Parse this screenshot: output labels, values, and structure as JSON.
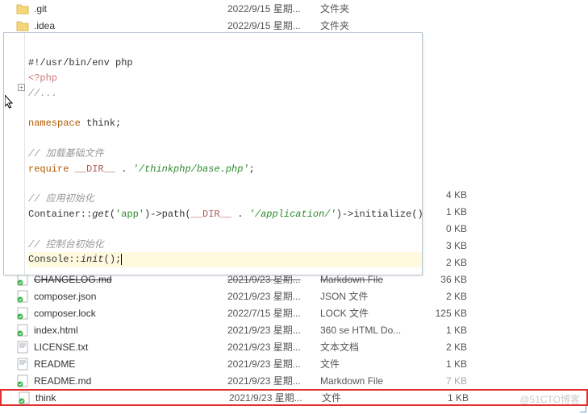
{
  "files": [
    {
      "name": ".git",
      "date": "2022/9/15 星期...",
      "type": "文件夹",
      "size": "",
      "icon": "folder"
    },
    {
      "name": ".idea",
      "date": "2022/9/15 星期...",
      "type": "文件夹",
      "size": "",
      "icon": "folder"
    },
    {
      "name": "",
      "date": "",
      "type": "",
      "size": "",
      "icon": ""
    },
    {
      "name": "",
      "date": "",
      "type": "",
      "size": "",
      "icon": ""
    },
    {
      "name": "",
      "date": "",
      "type": "",
      "size": "",
      "icon": ""
    },
    {
      "name": "",
      "date": "",
      "type": "",
      "size": "",
      "icon": ""
    },
    {
      "name": "",
      "date": "",
      "type": "",
      "size": "",
      "icon": ""
    },
    {
      "name": "",
      "date": "",
      "type": "",
      "size": "",
      "icon": ""
    },
    {
      "name": "",
      "date": "",
      "type": "",
      "size": "",
      "icon": ""
    },
    {
      "name": "",
      "date": "",
      "type": "",
      "size": "",
      "icon": ""
    },
    {
      "name": "",
      "date": "",
      "type": "",
      "size": "",
      "icon": ""
    },
    {
      "name": "",
      "date": "",
      "type": "",
      "size": "4 KB",
      "icon": ""
    },
    {
      "name": "",
      "date": "",
      "type": "",
      "size": "1 KB",
      "icon": ""
    },
    {
      "name": "",
      "date": "",
      "type": "",
      "size": "0 KB",
      "icon": ""
    },
    {
      "name": "",
      "date": "",
      "type": "",
      "size": "3 KB",
      "icon": ""
    },
    {
      "name": "",
      "date": "",
      "type": "",
      "size": "2 KB",
      "icon": ""
    },
    {
      "name": "CHANGELOG.md",
      "date": "2021/9/23 星期...",
      "type": "Markdown File",
      "size": "36 KB",
      "icon": "file-green",
      "truncated": true
    },
    {
      "name": "composer.json",
      "date": "2021/9/23 星期...",
      "type": "JSON 文件",
      "size": "2 KB",
      "icon": "file-green"
    },
    {
      "name": "composer.lock",
      "date": "2022/7/15 星期...",
      "type": "LOCK 文件",
      "size": "125 KB",
      "icon": "file-green"
    },
    {
      "name": "index.html",
      "date": "2021/9/23 星期...",
      "type": "360 se HTML Do...",
      "size": "1 KB",
      "icon": "file-green"
    },
    {
      "name": "LICENSE.txt",
      "date": "2021/9/23 星期...",
      "type": "文本文档",
      "size": "2 KB",
      "icon": "file-txt"
    },
    {
      "name": "README",
      "date": "2021/9/23 星期...",
      "type": "文件",
      "size": "1 KB",
      "icon": "file-txt"
    },
    {
      "name": "README.md",
      "date": "2021/9/23 星期...",
      "type": "Markdown File",
      "size": "7 KB",
      "icon": "file-green",
      "faded_size": true
    },
    {
      "name": "think",
      "date": "2021/9/23 星期...",
      "type": "文件",
      "size": "1 KB",
      "icon": "file-green",
      "highlighted": true
    }
  ],
  "code": {
    "line1": "#!/usr/bin/env php",
    "line2": "<?php",
    "line3": "//...",
    "line5_ns": "namespace",
    "line5_id": " think;",
    "line7": "// 加载基础文件",
    "line8_req": "require ",
    "line8_dir": "__DIR__",
    "line8_dot": " . ",
    "line8_str": "'/thinkphp/base.php'",
    "line8_semi": ";",
    "line10": "// 应用初始化",
    "line11_a": "Container::",
    "line11_b": "get",
    "line11_c": "(",
    "line11_d": "'app'",
    "line11_e": ")->path(",
    "line11_f": "__DIR__",
    "line11_g": " . ",
    "line11_h": "'/application/'",
    "line11_i": ")->initialize();",
    "line13": "// 控制台初始化",
    "line14_a": "Console::",
    "line14_b": "init",
    "line14_c": "();"
  },
  "watermark": "@51CTO博客",
  "gutter_plus": "+"
}
